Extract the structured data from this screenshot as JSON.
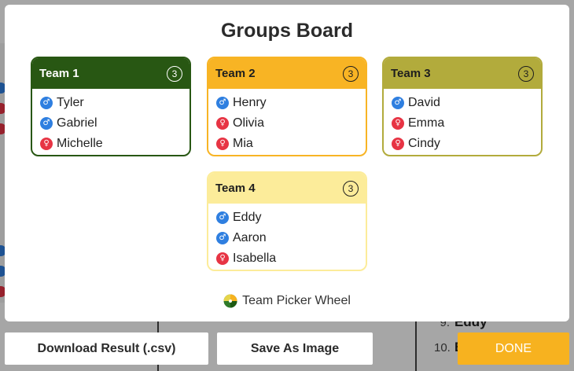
{
  "modal": {
    "title": "Groups Board",
    "teams": [
      {
        "name": "Team 1",
        "count": "3",
        "header_color": "#285713",
        "header_text_color": "#ffffff",
        "border_color": "#285713",
        "members": [
          {
            "name": "Tyler",
            "gender": "male"
          },
          {
            "name": "Gabriel",
            "gender": "male"
          },
          {
            "name": "Michelle",
            "gender": "female"
          }
        ]
      },
      {
        "name": "Team 2",
        "count": "3",
        "header_color": "#f8b424",
        "header_text_color": "#1e1e1e",
        "border_color": "#f8b424",
        "members": [
          {
            "name": "Henry",
            "gender": "male"
          },
          {
            "name": "Olivia",
            "gender": "female"
          },
          {
            "name": "Mia",
            "gender": "female"
          }
        ]
      },
      {
        "name": "Team 3",
        "count": "3",
        "header_color": "#b2ab3c",
        "header_text_color": "#1e1e1e",
        "border_color": "#b2ab3c",
        "members": [
          {
            "name": "David",
            "gender": "male"
          },
          {
            "name": "Emma",
            "gender": "female"
          },
          {
            "name": "Cindy",
            "gender": "female"
          }
        ]
      },
      {
        "name": "Team 4",
        "count": "3",
        "header_color": "#fcec9a",
        "header_text_color": "#1e1e1e",
        "border_color": "#fcec9a",
        "members": [
          {
            "name": "Eddy",
            "gender": "male"
          },
          {
            "name": "Aaron",
            "gender": "male"
          },
          {
            "name": "Isabella",
            "gender": "female"
          }
        ]
      }
    ],
    "brand": "Team Picker Wheel",
    "icons": {
      "male": "male-symbol-icon",
      "female": "female-symbol-icon",
      "brand": "picker-wheel-logo-icon"
    }
  },
  "buttons": {
    "download": "Download Result (.csv)",
    "save_image": "Save As Image",
    "done": "DONE",
    "done_color": "#f7b21f"
  },
  "background": {
    "list": [
      {
        "num": "9.",
        "name": "Eddy"
      },
      {
        "num": "10.",
        "name": "E"
      }
    ]
  }
}
